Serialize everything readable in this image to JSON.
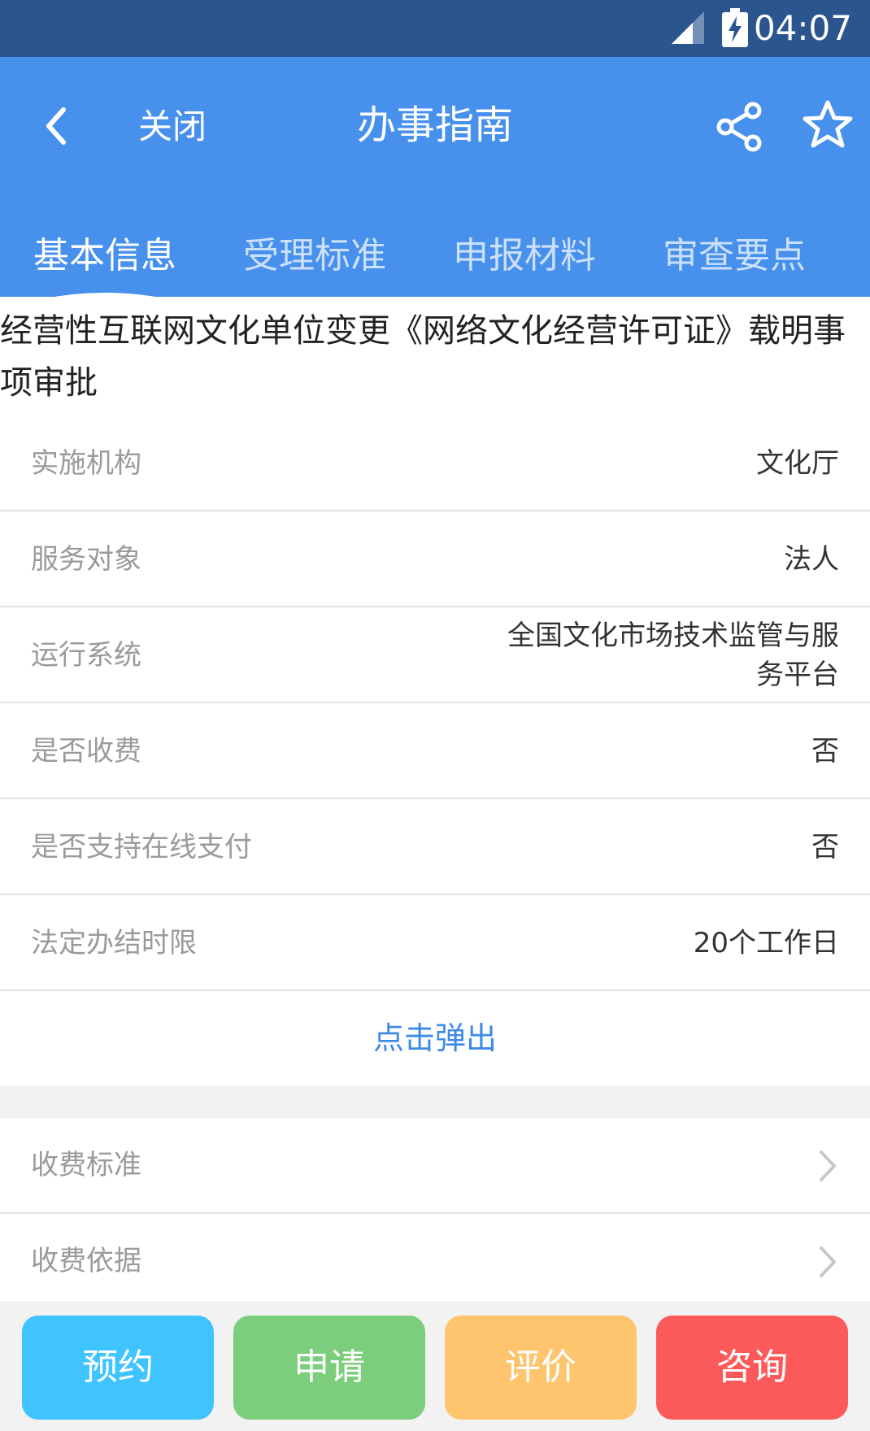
{
  "status_bar": {
    "time": "04:07"
  },
  "header": {
    "close_label": "关闭",
    "title": "办事指南",
    "tabs": [
      {
        "label": "基本信息",
        "active": true
      },
      {
        "label": "受理标准",
        "active": false
      },
      {
        "label": "申报材料",
        "active": false
      },
      {
        "label": "审查要点",
        "active": false
      }
    ]
  },
  "content": {
    "item_title": "经营性互联网文化单位变更《网络文化经营许可证》载明事项审批",
    "rows": [
      {
        "label": "实施机构",
        "value": "文化厅"
      },
      {
        "label": "服务对象",
        "value": "法人"
      },
      {
        "label": "运行系统",
        "value": "全国文化市场技术监管与服务平台"
      },
      {
        "label": "是否收费",
        "value": "否"
      },
      {
        "label": "是否支持在线支付",
        "value": "否"
      },
      {
        "label": "法定办结时限",
        "value": "20个工作日"
      }
    ],
    "expand_label": "点击弹出",
    "links": [
      {
        "label": "收费标准"
      },
      {
        "label": "收费依据"
      }
    ]
  },
  "actions": [
    {
      "label": "预约",
      "color": "#40c4ff"
    },
    {
      "label": "申请",
      "color": "#7ccd7c"
    },
    {
      "label": "评价",
      "color": "#ffc46e"
    },
    {
      "label": "咨询",
      "color": "#fc5a5a"
    }
  ],
  "colors": {
    "header_bg": "#4790ec",
    "status_bg": "#2b558f",
    "link_blue": "#3e8be6"
  }
}
